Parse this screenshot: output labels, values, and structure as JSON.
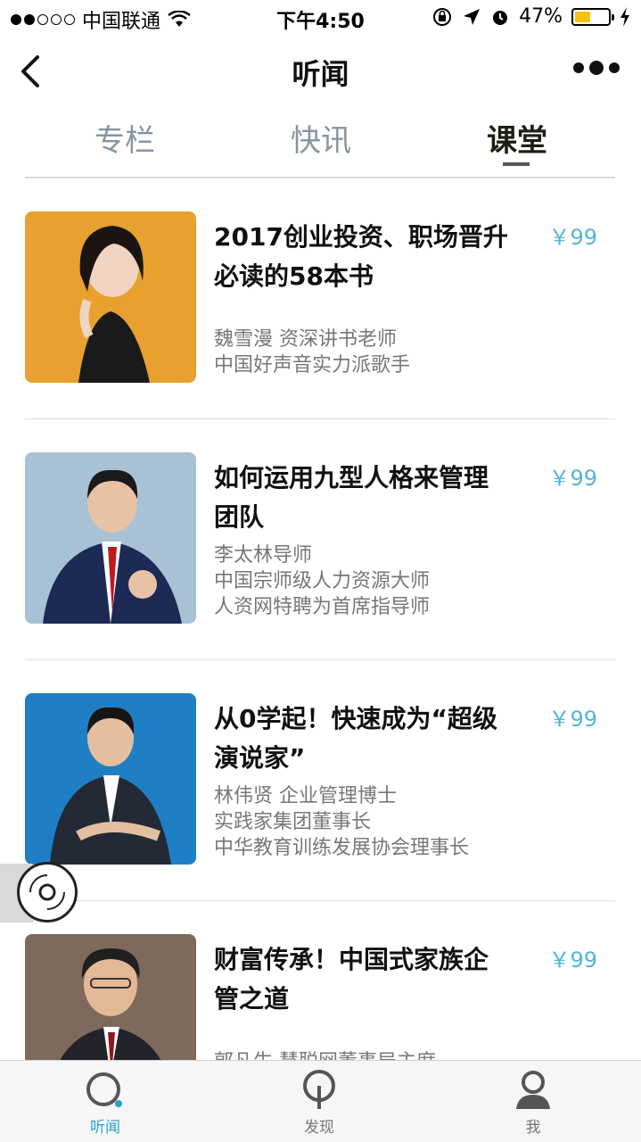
{
  "status_bar": {
    "carrier": "中国联通",
    "time": "下午4:50",
    "battery": "47%",
    "battery_level": 0.47
  },
  "nav": {
    "title": "听闻"
  },
  "tabs": [
    {
      "label": "专栏",
      "active": false
    },
    {
      "label": "快讯",
      "active": false
    },
    {
      "label": "课堂",
      "active": true
    }
  ],
  "courses": [
    {
      "title": "2017创业投资、职场晋升必读的58本书",
      "price": "￥99",
      "desc": [
        "魏雪漫 资深讲书老师",
        "中国好声音实力派歌手"
      ],
      "thumb_bg": "#e8a12f"
    },
    {
      "title": "如何运用九型人格来管理团队",
      "price": "￥99",
      "desc": [
        "李太林导师",
        "中国宗师级人力资源大师",
        "人资网特聘为首席指导师"
      ],
      "thumb_bg": "#a9c1d4"
    },
    {
      "title": "从0学起！快速成为“超级演说家”",
      "price": "￥99",
      "desc": [
        "林伟贤 企业管理博士",
        "实践家集团董事长",
        "中华教育训练发展协会理事长"
      ],
      "thumb_bg": "#1f7fc4"
    },
    {
      "title": "财富传承！中国式家族企管之道",
      "price": "￥99",
      "desc": [
        "郭凡生 慧聪网董事局主席"
      ],
      "thumb_bg": "#7d6a5c"
    }
  ],
  "bottom_tabs": [
    {
      "label": "听闻",
      "icon": "listen-icon",
      "active": true
    },
    {
      "label": "发现",
      "icon": "discover-icon",
      "active": false
    },
    {
      "label": "我",
      "icon": "profile-icon",
      "active": false
    }
  ],
  "colors": {
    "accent": "#2d9fd4",
    "price": "#52b6d6",
    "tab_inactive": "#8795a3"
  }
}
